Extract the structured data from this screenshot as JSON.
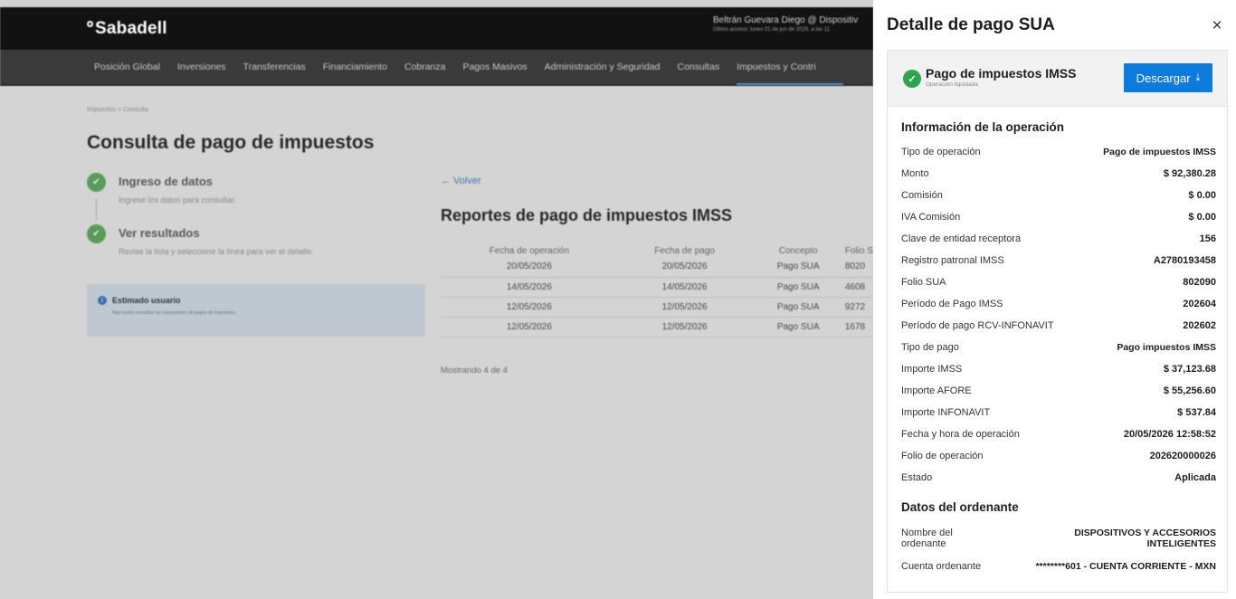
{
  "background": {
    "logo": "Sabadell",
    "user": {
      "name": "Beltrán Guevara Diego @ Dispositiv",
      "last_access": "Último acceso: lunes 01 de jun de 2026, a las 11"
    },
    "nav": [
      "Posición Global",
      "Inversiones",
      "Transferencias",
      "Financiamiento",
      "Cobranza",
      "Pagos Masivos",
      "Administración y Seguridad",
      "Consultas",
      "Impuestos y Contri"
    ],
    "breadcrumb": "Impuestos  >  Consulta",
    "page_title": "Consulta de pago de impuestos",
    "steps": [
      {
        "title": "Ingreso de datos",
        "desc": "Ingrese los datos para consultar."
      },
      {
        "title": "Ver resultados",
        "desc": "Revise la lista y seleccione la línea para ver el detalle."
      }
    ],
    "info": {
      "title": "Estimado usuario",
      "desc": "Aquí podrá consultar las operaciones de pagos de impuestos."
    },
    "back_label": "← Volver",
    "report_title": "Reportes de pago de impuestos IMSS",
    "table": {
      "headers": [
        "Fecha de operación",
        "Fecha de pago",
        "Concepto",
        "Folio S"
      ],
      "rows": [
        [
          "20/05/2026",
          "20/05/2026",
          "Pago SUA",
          "8020"
        ],
        [
          "14/05/2026",
          "14/05/2026",
          "Pago SUA",
          "4608"
        ],
        [
          "12/05/2026",
          "12/05/2026",
          "Pago SUA",
          "9272"
        ],
        [
          "12/05/2026",
          "12/05/2026",
          "Pago SUA",
          "1678"
        ]
      ]
    },
    "showing": "Mostrando 4 de 4"
  },
  "panel": {
    "title": "Detalle de pago SUA",
    "close": "×",
    "heading": "Pago de impuestos IMSS",
    "subheading": "Operación liquidada",
    "download_label": "Descargar",
    "section_operation": "Información de la operación",
    "operation_rows": [
      {
        "label": "Tipo de operación",
        "value": "Pago de impuestos IMSS"
      },
      {
        "label": "Monto",
        "value": "$ 92,380.28"
      },
      {
        "label": "Comisión",
        "value": "$ 0.00"
      },
      {
        "label": "IVA Comisión",
        "value": "$ 0.00"
      },
      {
        "label": "Clave de entidad receptora",
        "value": "156"
      },
      {
        "label": "Registro patronal IMSS",
        "value": "A2780193458"
      },
      {
        "label": "Folio SUA",
        "value": "802090"
      },
      {
        "label": "Período de Pago IMSS",
        "value": "202604"
      },
      {
        "label": "Período de pago RCV-INFONAVIT",
        "value": "202602"
      },
      {
        "label": "Tipo de pago",
        "value": "Pago impuestos IMSS"
      },
      {
        "label": "Importe IMSS",
        "value": "$ 37,123.68"
      },
      {
        "label": "Importe AFORE",
        "value": "$ 55,256.60"
      },
      {
        "label": "Importe INFONAVIT",
        "value": "$ 537.84"
      },
      {
        "label": "Fecha y hora de operación",
        "value": "20/05/2026 12:58:52"
      },
      {
        "label": "Folio de operación",
        "value": "202620000026"
      },
      {
        "label": "Estado",
        "value": "Aplicada"
      }
    ],
    "section_ordering": "Datos del ordenante",
    "ordering_rows": [
      {
        "label": "Nombre del ordenante",
        "value": "DISPOSITIVOS Y ACCESORIOS INTELIGENTES"
      },
      {
        "label": "Cuenta ordenante",
        "value": "********601 - CUENTA CORRIENTE - MXN"
      }
    ]
  },
  "colors": {
    "primary_button": "#0c7bdc",
    "success": "#2ea44f",
    "topbar": "#121212"
  }
}
